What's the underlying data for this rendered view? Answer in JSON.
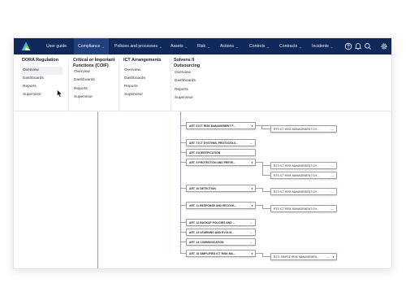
{
  "nav": {
    "items": [
      {
        "label": "User guide",
        "has_chevron": false
      },
      {
        "label": "Compliance",
        "has_chevron": true,
        "active": true
      },
      {
        "label": "Policies and processes",
        "has_chevron": true
      },
      {
        "label": "Assets",
        "has_chevron": true
      },
      {
        "label": "Risk",
        "has_chevron": true
      },
      {
        "label": "Actions",
        "has_chevron": true
      },
      {
        "label": "Controls",
        "has_chevron": true
      },
      {
        "label": "Contracts",
        "has_chevron": true
      },
      {
        "label": "Incidents",
        "has_chevron": true
      }
    ],
    "chevron": "⌄",
    "icons": [
      "help-icon",
      "bell-icon",
      "search-icon",
      "settings-icon"
    ]
  },
  "menu": {
    "columns": [
      {
        "title": "DORA Regulation",
        "items": [
          "Overview",
          "Dashboards",
          "Reports",
          "Supervisor"
        ],
        "hover": 0
      },
      {
        "title": "Critical or Important Functions (COIF)",
        "items": [
          "Overview",
          "Dashboards",
          "Reports",
          "Supervisor"
        ]
      },
      {
        "title": "ICT Arrangements",
        "items": [
          "Overview",
          "Dashboards",
          "Reports",
          "Supervisor"
        ]
      },
      {
        "title": "Solvens II Outsourcing",
        "items": [
          "Overview",
          "Dashboards",
          "Reports",
          "Supervisor"
        ]
      }
    ]
  },
  "tree": {
    "dash": "---",
    "articles": [
      {
        "label": "ART. 6 ICT RISK MANAGEMENT F...",
        "expandable": true
      },
      {
        "label": "ART. 7 ICT SYSTEMS, PROTOCOLS...",
        "expandable": false
      },
      {
        "label": "ART. 8 IDENTIFICATION",
        "expandable": false
      },
      {
        "label": "ART. 9 PROTECTION AND PREVE...",
        "expandable": true
      },
      {
        "label": "ART. 10 DETECTION",
        "expandable": true
      },
      {
        "label": "ART. 11 RESPONSE AND RECOVE...",
        "expandable": true
      },
      {
        "label": "ART. 12 BACKUP POLICIES AND ...",
        "expandable": false
      },
      {
        "label": "ART. 13 LEARNING AND EVOLVI...",
        "expandable": false
      },
      {
        "label": "ART. 14 COMMUNICATION",
        "expandable": false
      },
      {
        "label": "ART. 16 SIMPLIFIED ICT RISK MA...",
        "expandable": true
      }
    ],
    "rts": [
      {
        "label": "RTS ICT RISK MANAGEMENT CH...",
        "expandable": false
      },
      {
        "label": "RTS ICT RISK MANAGEMENT CH...",
        "expandable": false
      },
      {
        "label": "RTS ICT RISK MANAGEMENT CH...",
        "expandable": false
      },
      {
        "label": "RTS ICT RISK MANAGEMENT CH...",
        "expandable": false
      },
      {
        "label": "RTS ICT RISK MANAGEMENT CH...",
        "expandable": false
      },
      {
        "label": "RTS: SIMPLE RISK MANAGEMEN...",
        "expandable": true
      }
    ]
  }
}
